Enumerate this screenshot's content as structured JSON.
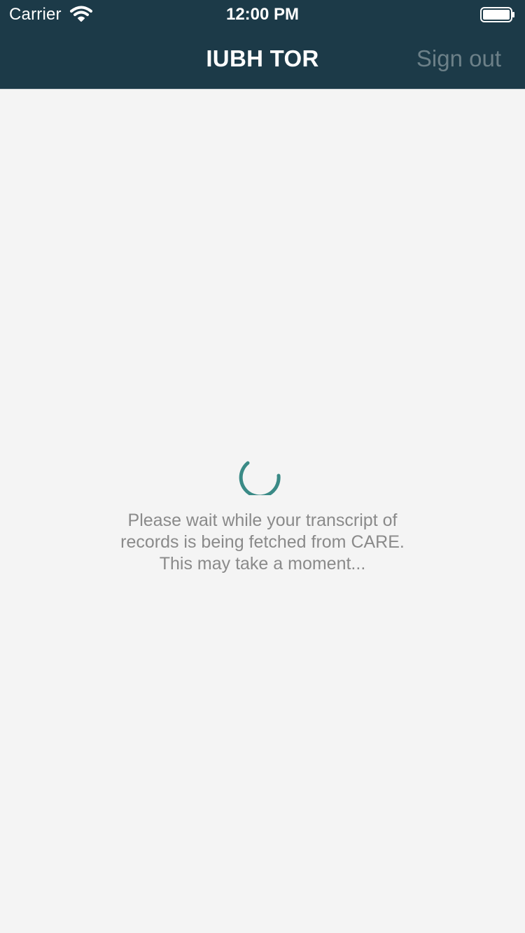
{
  "status_bar": {
    "carrier": "Carrier",
    "time": "12:00 PM",
    "wifi_icon": "wifi-icon",
    "battery_icon": "battery-icon"
  },
  "nav_bar": {
    "title": "IUBH TOR",
    "sign_out_label": "Sign out"
  },
  "loading": {
    "spinner_icon": "spinner-icon",
    "spinner_color": "#3a8a86",
    "message_line1": "Please wait while your transcript of",
    "message_line2": "records is being fetched from CARE.",
    "message_line3": "This may take a moment..."
  },
  "colors": {
    "header_background": "#1c3a48",
    "page_background": "#f4f4f4",
    "sign_out_text": "#6c8088",
    "message_text": "#8a8a8a"
  }
}
